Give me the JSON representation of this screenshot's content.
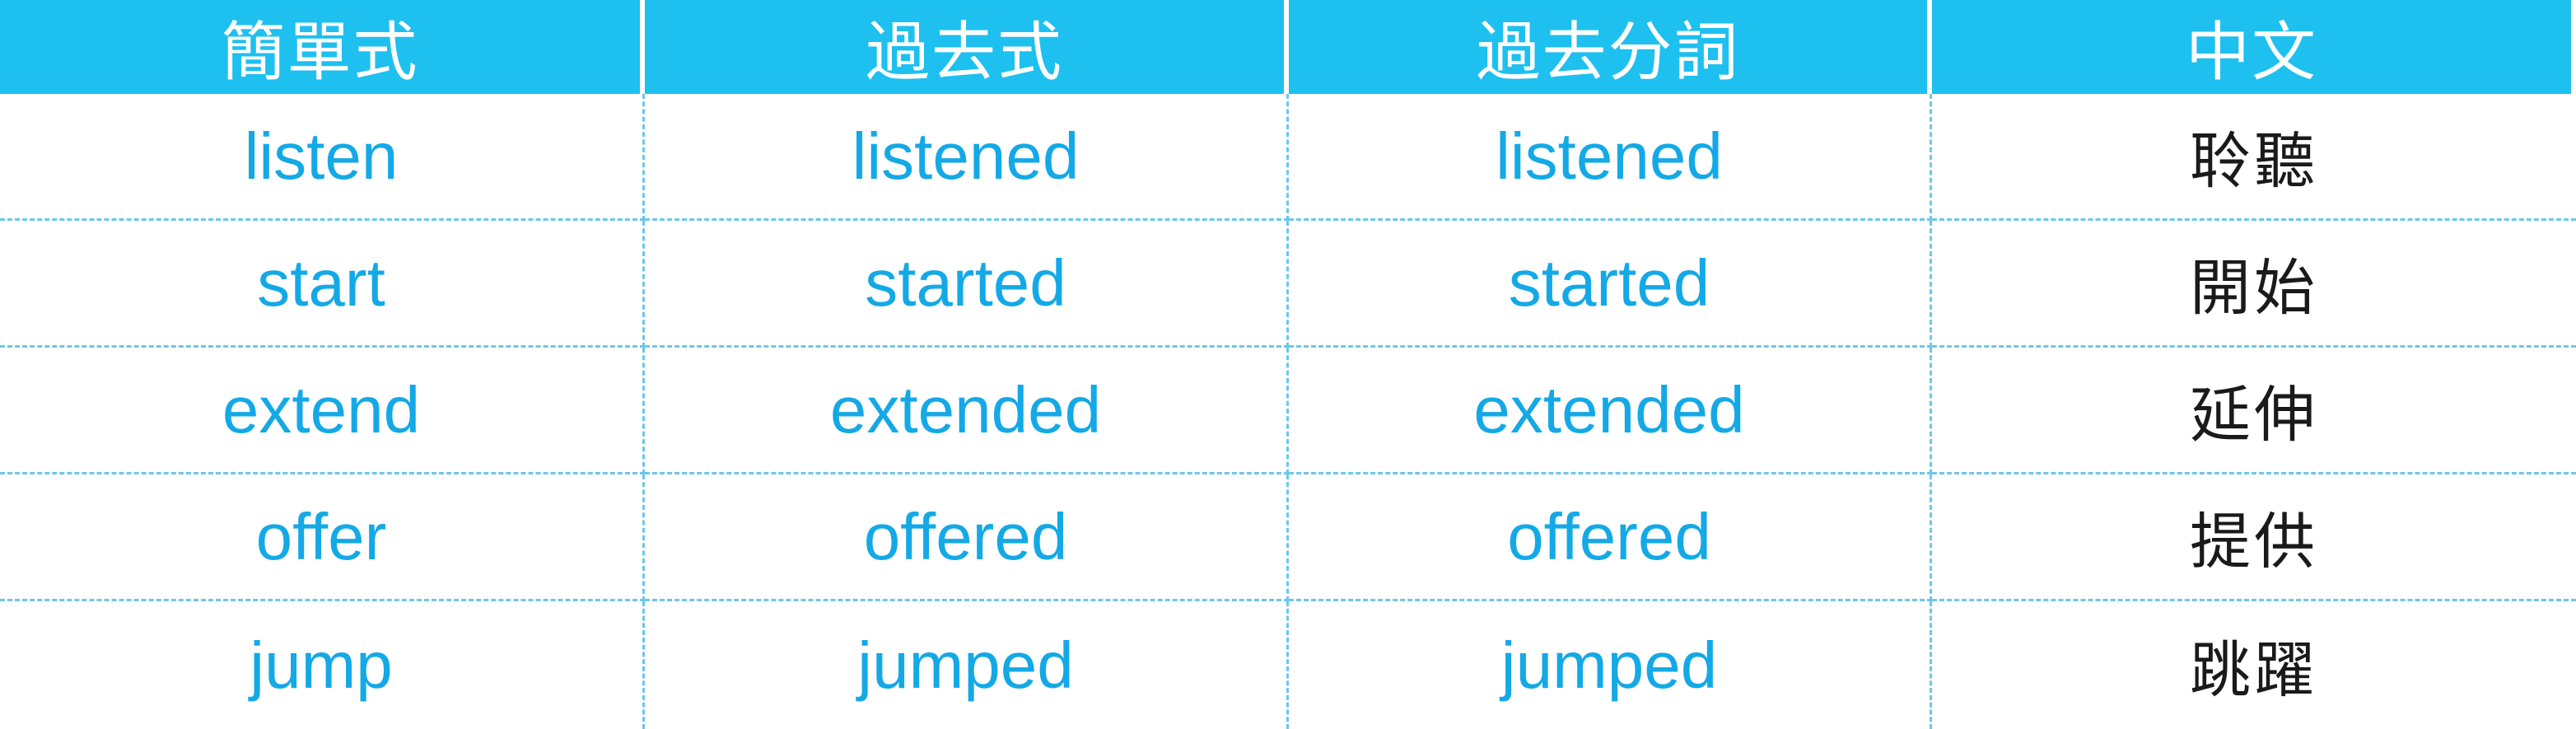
{
  "table": {
    "headers": [
      "簡單式",
      "過去式",
      "過去分詞",
      "中文"
    ],
    "rows": [
      [
        "listen",
        "listened",
        "listened",
        "聆聽"
      ],
      [
        "start",
        "started",
        "started",
        "開始"
      ],
      [
        "extend",
        "extended",
        "extended",
        "延伸"
      ],
      [
        "offer",
        "offered",
        "offered",
        "提供"
      ],
      [
        "jump",
        "jumped",
        "jumped",
        "跳躍"
      ]
    ]
  },
  "colors": {
    "header_background": "#1dc0ef",
    "header_text": "#ffffff",
    "english_text": "#14a9e6",
    "chinese_text": "#1a1a1a",
    "row_divider": "#6cc7ea"
  }
}
